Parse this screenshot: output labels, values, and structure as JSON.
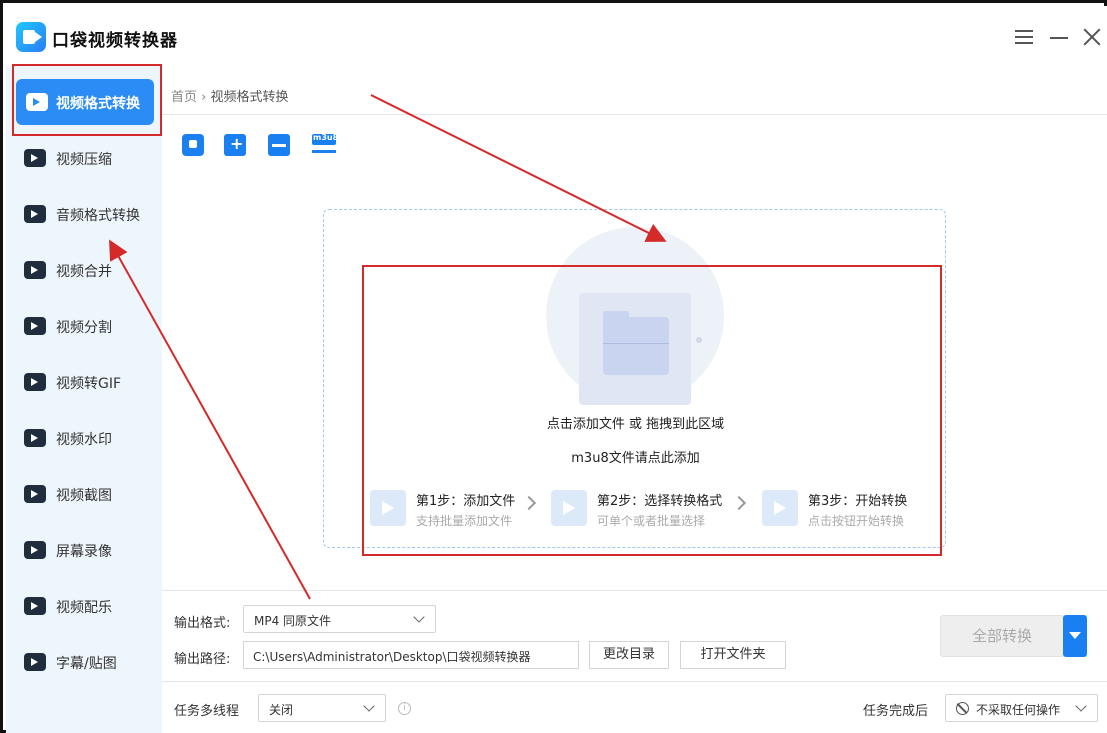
{
  "app": {
    "title": "口袋视频转换器"
  },
  "sidebar": {
    "items": [
      {
        "label": "视频格式转换",
        "icon": "video-convert-icon"
      },
      {
        "label": "视频压缩",
        "icon": "compress-icon"
      },
      {
        "label": "音频格式转换",
        "icon": "audio-convert-icon"
      },
      {
        "label": "视频合并",
        "icon": "merge-icon"
      },
      {
        "label": "视频分割",
        "icon": "split-icon"
      },
      {
        "label": "视频转GIF",
        "icon": "gif-icon"
      },
      {
        "label": "视频水印",
        "icon": "watermark-icon"
      },
      {
        "label": "视频截图",
        "icon": "screenshot-icon"
      },
      {
        "label": "屏幕录像",
        "icon": "screen-record-icon"
      },
      {
        "label": "视频配乐",
        "icon": "music-icon"
      },
      {
        "label": "字幕/贴图",
        "icon": "subtitle-icon"
      }
    ]
  },
  "breadcrumb": {
    "home": "首页",
    "sep": "›",
    "current": "视频格式转换"
  },
  "toolbar": {
    "m3u8_text": "m3u8"
  },
  "dropzone": {
    "main_text": "点击添加文件 或 拖拽到此区域",
    "m3u8_text": "m3u8文件请点此添加",
    "steps": [
      {
        "title": "第1步：添加文件",
        "desc": "支持批量添加文件"
      },
      {
        "title": "第2步：选择转换格式",
        "desc": "可单个或者批量选择"
      },
      {
        "title": "第3步：开始转换",
        "desc": "点击按钮开始转换"
      }
    ]
  },
  "output": {
    "format_label": "输出格式:",
    "format_value": "MP4  同原文件",
    "path_label": "输出路径:",
    "path_value": "C:\\Users\\Administrator\\Desktop\\口袋视频转换器",
    "change_dir_label": "更改目录",
    "open_folder_label": "打开文件夹",
    "convert_all_label": "全部转换"
  },
  "footer": {
    "multithread_label": "任务多线程",
    "multithread_value": "关闭",
    "info_text": "i",
    "after_done_label": "任务完成后",
    "after_done_value": "不采取任何操作"
  },
  "colors": {
    "accent": "#2a8cf4",
    "annotation": "#d42a2a",
    "sidebar_bg": "#eef6fd"
  }
}
